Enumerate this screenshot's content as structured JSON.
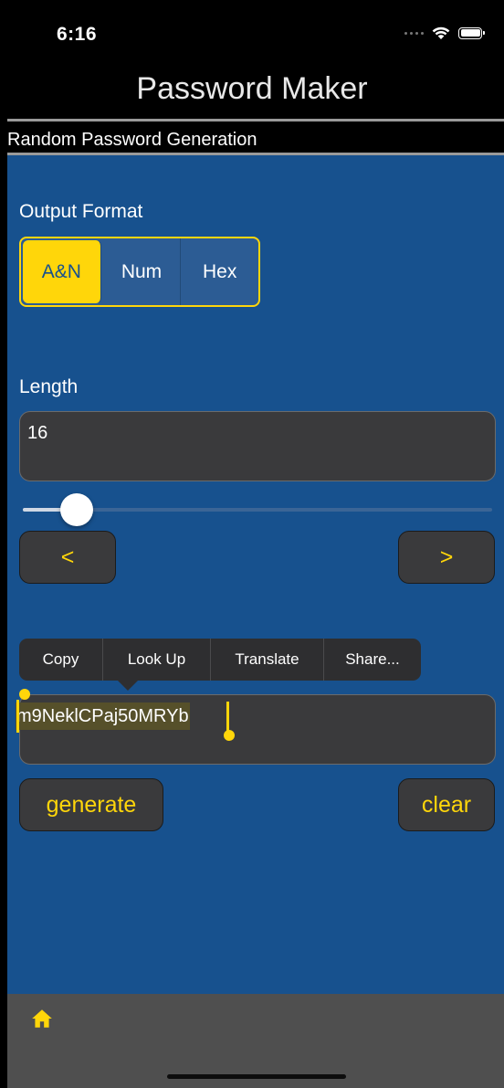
{
  "status_bar": {
    "time": "6:16"
  },
  "nav": {
    "title": "Password Maker"
  },
  "header": {
    "subtitle": "Random Password Generation"
  },
  "output_format": {
    "label": "Output Format",
    "options": [
      "A&N",
      "Num",
      "Hex"
    ],
    "selected": "A&N"
  },
  "length": {
    "label": "Length",
    "value": "16",
    "slider_fraction": 0.08,
    "decrement_label": "<",
    "increment_label": ">"
  },
  "edit_menu": {
    "items": [
      "Copy",
      "Look Up",
      "Translate",
      "Share..."
    ]
  },
  "password": {
    "value": "m9NeklCPaj50MRYb"
  },
  "actions": {
    "generate_label": "generate",
    "clear_label": "clear"
  },
  "tab_bar": {
    "items": [
      {
        "icon": "home-icon",
        "selected": true
      }
    ]
  },
  "colors": {
    "accent": "#ffd60a",
    "background": "#17518e",
    "field": "#3a3a3c",
    "tab_bar": "#4f4f4f"
  }
}
